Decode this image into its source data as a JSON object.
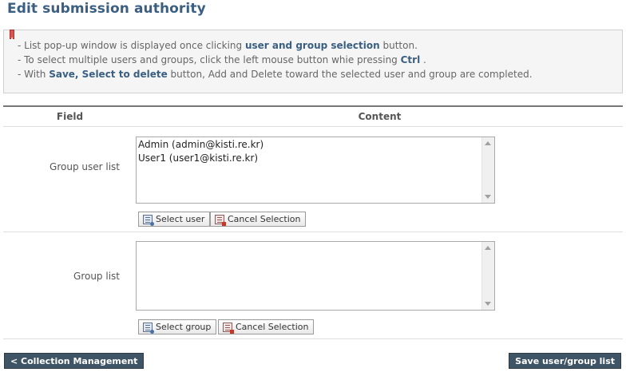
{
  "page": {
    "title": "Edit submission authority"
  },
  "info": {
    "line1": {
      "pre": "- List pop-up window is displayed once clicking ",
      "bold": "user and group selection",
      "post": " button."
    },
    "line2": {
      "pre": "- To select multiple users and groups, click the left mouse button whie pressing ",
      "bold": "Ctrl",
      "post": " ."
    },
    "line3": {
      "pre": "- With ",
      "bold": "Save, Select to delete",
      "post": " button, Add and Delete toward the selected user and group are completed."
    }
  },
  "table": {
    "header_field": "Field",
    "header_content": "Content",
    "group_user": {
      "label": "Group user list",
      "items": [
        "Admin (admin@kisti.re.kr)",
        "User1 (user1@kisti.re.kr)"
      ],
      "select_label": "Select user",
      "cancel_label": "Cancel Selection"
    },
    "group": {
      "label": "Group list",
      "items": [],
      "select_label": "Select group",
      "cancel_label": "Cancel Selection"
    }
  },
  "footer": {
    "back_label": "< Collection Management",
    "save_label": "Save user/group list"
  },
  "icons": {
    "bookmark": "bookmark-icon",
    "select": "user-select-icon",
    "cancel": "cancel-selection-icon",
    "scroll_up": "scroll-up-arrow-icon",
    "scroll_down": "scroll-down-arrow-icon"
  },
  "colors": {
    "title": "#3a5f82",
    "accent_bold": "#3a5f82",
    "dark_button": "#3f5565",
    "bookmark": "#d9534f"
  }
}
